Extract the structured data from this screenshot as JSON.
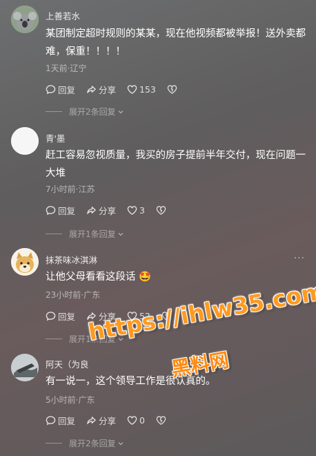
{
  "comments": [
    {
      "username": "上善若水",
      "text": "某团制定超时规则的某某，现在他视频都被举报！送外卖都难，保重！！！！",
      "meta": "1天前·辽宁",
      "reply_label": "回复",
      "share_label": "分享",
      "likes": "153",
      "expand_label": "展开2条回复",
      "avatar": "koala-avatar"
    },
    {
      "username": "青'墨",
      "text": "赶工容易忽视质量，我买的房子提前半年交付，现在问题一大堆",
      "meta": "7小时前·江苏",
      "reply_label": "回复",
      "share_label": "分享",
      "likes": "3",
      "expand_label": "展开1条回复",
      "avatar": "white-avatar"
    },
    {
      "username": "抹茶味冰淇淋",
      "text": "让他父母看看这段话 🤩",
      "meta": "23小时前·广东",
      "reply_label": "回复",
      "share_label": "分享",
      "likes": "52",
      "expand_label": "展开1条回复",
      "avatar": "doge-avatar"
    },
    {
      "username": "阿天（为良",
      "text": "有一说一，这个领导工作是很认真的。",
      "meta": "5小时前·广东",
      "reply_label": "回复",
      "share_label": "分享",
      "likes": "0",
      "expand_label": "展开2条回复",
      "avatar": "photo-avatar"
    }
  ],
  "more_label": "···",
  "watermark": {
    "url": "https://ihlw35.com",
    "name": "黑料网"
  }
}
